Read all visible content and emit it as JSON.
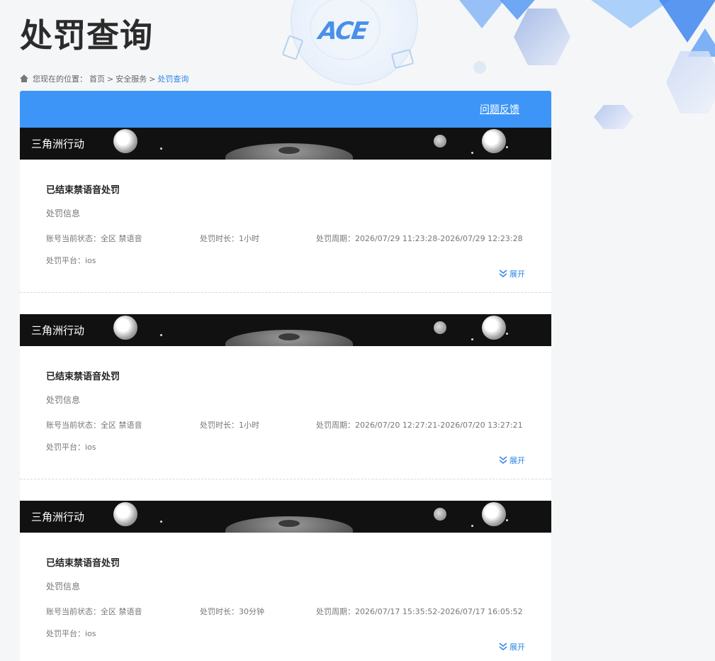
{
  "page": {
    "title": "处罚查询"
  },
  "breadcrumb": {
    "prefix": "您现在的位置：",
    "home": "首页",
    "sep1": ">",
    "section": "安全服务",
    "sep2": ">",
    "current": "处罚查询"
  },
  "panel": {
    "feedback_label": "问题反馈"
  },
  "records": [
    {
      "game": "三角洲行动",
      "title": "已结束禁语音处罚",
      "subtitle": "处罚信息",
      "status": "账号当前状态：全区 禁语音",
      "duration": "处罚时长：1小时",
      "period": "处罚周期：2026/07/29 11:23:28-2026/07/29 12:23:28",
      "platform": "处罚平台：ios",
      "expand_label": "展开"
    },
    {
      "game": "三角洲行动",
      "title": "已结束禁语音处罚",
      "subtitle": "处罚信息",
      "status": "账号当前状态：全区 禁语音",
      "duration": "处罚时长：1小时",
      "period": "处罚周期：2026/07/20 12:27:21-2026/07/20 13:27:21",
      "platform": "处罚平台：ios",
      "expand_label": "展开"
    },
    {
      "game": "三角洲行动",
      "title": "已结束禁语音处罚",
      "subtitle": "处罚信息",
      "status": "账号当前状态：全区 禁语音",
      "duration": "处罚时长：30分钟",
      "period": "处罚周期：2026/07/17 15:35:52-2026/07/17 16:05:52",
      "platform": "处罚平台：ios",
      "expand_label": "展开"
    }
  ],
  "colors": {
    "accent": "#3d96f7",
    "link": "#2f86e8"
  },
  "icons": {
    "breadcrumb": "home-icon",
    "expand": "chevron-double-down-icon"
  }
}
